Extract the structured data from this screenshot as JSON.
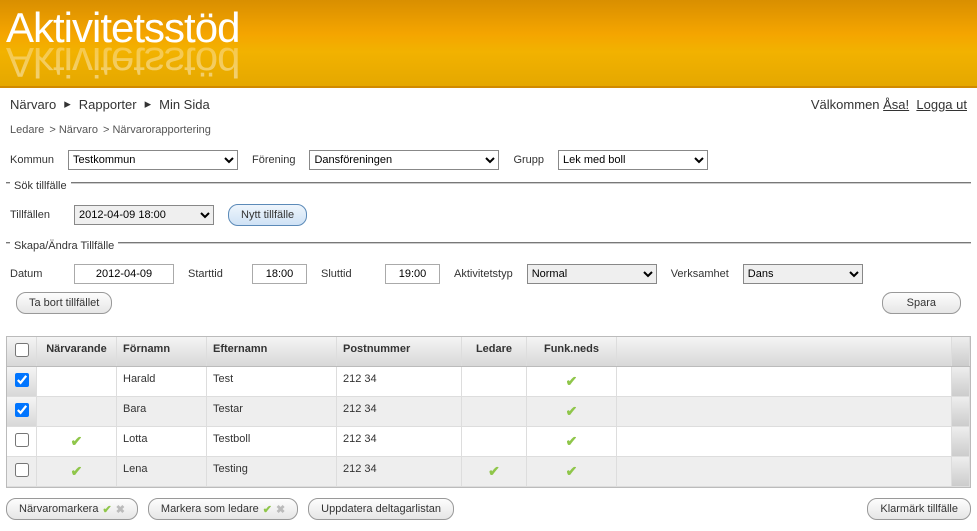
{
  "logo": "Aktivitetsstöd",
  "nav": {
    "items": [
      "Närvaro",
      "Rapporter",
      "Min Sida"
    ],
    "welcome_prefix": "Välkommen ",
    "user": "Åsa!",
    "logout": "Logga ut"
  },
  "breadcrumb": [
    "Ledare",
    "Närvaro",
    "Närvarorapportering"
  ],
  "filters": {
    "kommun_label": "Kommun",
    "kommun_value": "Testkommun",
    "forening_label": "Förening",
    "forening_value": "Dansföreningen",
    "grupp_label": "Grupp",
    "grupp_value": "Lek med boll"
  },
  "sok": {
    "legend": "Sök tillfälle",
    "tillfallen_label": "Tillfällen",
    "tillfallen_value": "2012-04-09 18:00",
    "nytt_btn": "Nytt tillfälle"
  },
  "skapa": {
    "legend": "Skapa/Ändra Tillfälle",
    "datum_label": "Datum",
    "datum_value": "2012-04-09",
    "starttid_label": "Starttid",
    "starttid_value": "18:00",
    "sluttid_label": "Sluttid",
    "sluttid_value": "19:00",
    "aktivitetstyp_label": "Aktivitetstyp",
    "aktivitetstyp_value": "Normal",
    "verksamhet_label": "Verksamhet",
    "verksamhet_value": "Dans",
    "ta_bort_btn": "Ta bort tillfället",
    "spara_btn": "Spara"
  },
  "table": {
    "headers": {
      "narv": "Närvarande",
      "fn": "Förnamn",
      "en": "Efternamn",
      "pn": "Postnummer",
      "led": "Ledare",
      "funk": "Funk.neds"
    },
    "rows": [
      {
        "checked": true,
        "narv": false,
        "fn": "Harald",
        "en": "Test",
        "pn": "212 34",
        "led": false,
        "funk": true
      },
      {
        "checked": true,
        "narv": false,
        "fn": "Bara",
        "en": "Testar",
        "pn": "212 34",
        "led": false,
        "funk": true
      },
      {
        "checked": false,
        "narv": true,
        "fn": "Lotta",
        "en": "Testboll",
        "pn": "212 34",
        "led": false,
        "funk": true
      },
      {
        "checked": false,
        "narv": true,
        "fn": "Lena",
        "en": "Testing",
        "pn": "212 34",
        "led": true,
        "funk": true
      }
    ]
  },
  "footer": {
    "narvaromarkera": "Närvaromarkera",
    "markera_ledare": "Markera som ledare",
    "uppdatera": "Uppdatera deltagarlistan",
    "klarmark": "Klarmärk tillfälle"
  }
}
